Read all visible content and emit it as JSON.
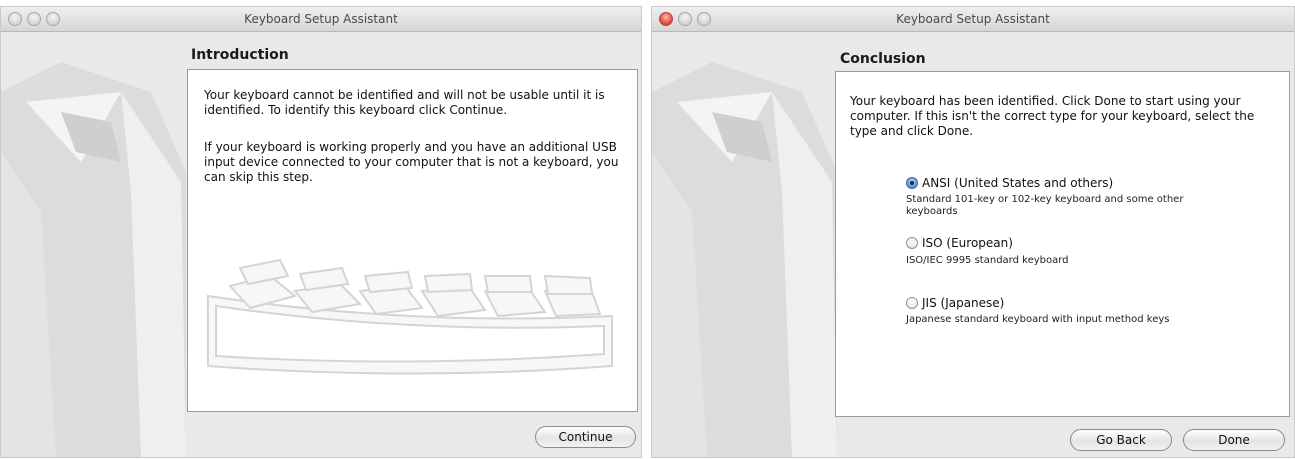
{
  "left_window": {
    "title": "Keyboard Setup Assistant",
    "heading": "Introduction",
    "paragraph1": "Your keyboard cannot be identified and will not be usable until it is identified. To identify this keyboard click Continue.",
    "paragraph2": "If your keyboard is working properly and you have an additional USB input device connected to your computer that is not a keyboard, you can skip this step.",
    "continue_label": "Continue"
  },
  "right_window": {
    "title": "Keyboard Setup Assistant",
    "heading": "Conclusion",
    "paragraph": "Your keyboard has been identified. Click Done to start using your computer. If this isn't the correct type for your keyboard, select the type and click Done.",
    "options": [
      {
        "label": "ANSI (United States and others)",
        "description": "Standard 101-key or 102-key keyboard and some other keyboards",
        "selected": true
      },
      {
        "label": "ISO (European)",
        "description": "ISO/IEC 9995 standard keyboard",
        "selected": false
      },
      {
        "label": "JIS (Japanese)",
        "description": "Japanese standard keyboard with input method keys",
        "selected": false
      }
    ],
    "go_back_label": "Go Back",
    "done_label": "Done"
  },
  "icons": {
    "traffic_lights": [
      "close-icon",
      "minimize-icon",
      "zoom-icon"
    ],
    "backdrop": "tuxedo-illustration",
    "keyboard": "keyboard-illustration"
  },
  "colors": {
    "close_button_active": "#d9453a",
    "radio_selected": "#5d8fd6"
  }
}
